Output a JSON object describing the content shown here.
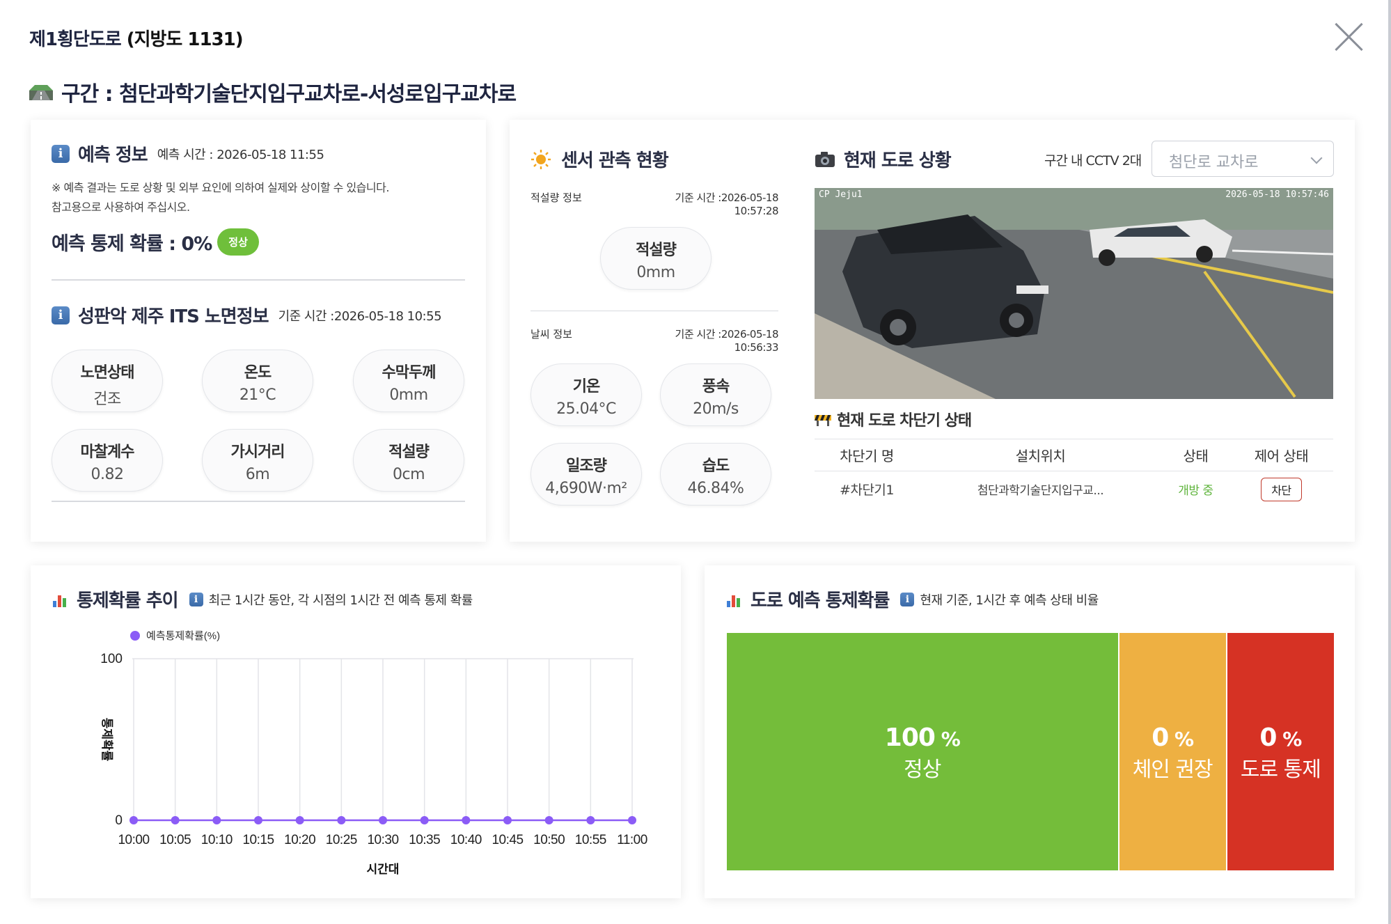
{
  "header": {
    "road_name": "제1횡단도로",
    "road_code": "(지방도 1131)",
    "section": "구간 : 첨단과학기술단지입구교차로-서성로입구교차로"
  },
  "prediction": {
    "title": "예측 정보",
    "time": "예측 시간 : 2026-05-18 11:55",
    "note_line1": "※ 예측 결과는 도로 상황 및 외부 요인에 의하여 실제와 상이할 수 있습니다.",
    "note_line2": "참고용으로 사용하여 주십시오.",
    "prob_label": "예측 통제 확률 : 0%",
    "badge": "정상"
  },
  "its": {
    "title": "성판악 제주 ITS 노면정보",
    "time": "기준 시간 :2026-05-18 10:55",
    "items": [
      {
        "label": "노면상태",
        "value": "건조"
      },
      {
        "label": "온도",
        "value": "21°C"
      },
      {
        "label": "수막두께",
        "value": "0mm"
      },
      {
        "label": "마찰계수",
        "value": "0.82"
      },
      {
        "label": "가시거리",
        "value": "6m"
      },
      {
        "label": "적설량",
        "value": "0cm"
      }
    ]
  },
  "sensor": {
    "title": "센서 관측 현황",
    "snow_label": "적설량 정보",
    "snow_time": "기준 시간 :2026-05-18 10:57:28",
    "snow": {
      "label": "적설량",
      "value": "0mm"
    },
    "weather_label": "날씨 정보",
    "weather_time": "기준 시간 :2026-05-18 10:56:33",
    "weather": [
      {
        "label": "기온",
        "value": "25.04°C"
      },
      {
        "label": "풍속",
        "value": "20m/s"
      },
      {
        "label": "일조량",
        "value": "4,690W·m²"
      },
      {
        "label": "습도",
        "value": "46.84%"
      }
    ]
  },
  "road_status": {
    "title": "현재 도로 상황",
    "cctv_count": "구간 내 CCTV 2대",
    "cctv_select": "첨단로 교차로",
    "cctv_timestamp": "2026-05-18 10:57:46",
    "cctv_tag": "CP Jeju1",
    "barrier_title": "현재 도로 차단기 상태",
    "barrier_headers": [
      "차단기 명",
      "설치위치",
      "상태",
      "제어 상태"
    ],
    "barrier_rows": [
      {
        "name": "#차단기1",
        "location": "첨단과학기술단지입구교...",
        "status": "개방 중",
        "control": "차단"
      }
    ]
  },
  "trend": {
    "title": "통제확률 추이",
    "desc": "최근 1시간 동안, 각 시점의 1시간 전 예측 통제 확률"
  },
  "forecast": {
    "title": "도로 예측 통제확률",
    "desc": "현재 기준, 1시간 후 예측 상태 비율",
    "segments": [
      {
        "pct": "100",
        "unit": "%",
        "label": "정상",
        "value": 100,
        "color": "#74bd3a"
      },
      {
        "pct": "0",
        "unit": "%",
        "label": "체인 권장",
        "value": 0,
        "color": "#eeb042"
      },
      {
        "pct": "0",
        "unit": "%",
        "label": "도로 통제",
        "value": 0,
        "color": "#d63224"
      }
    ]
  },
  "chart_data": {
    "type": "line",
    "title": "",
    "xlabel": "시간대",
    "ylabel": "통제확률",
    "ylim": [
      0,
      100
    ],
    "yticks": [
      "0",
      "100"
    ],
    "legend": "top-left",
    "grid": true,
    "series_color": "#8b5cf6",
    "x": [
      "10:00",
      "10:05",
      "10:10",
      "10:15",
      "10:20",
      "10:25",
      "10:30",
      "10:35",
      "10:40",
      "10:45",
      "10:50",
      "10:55",
      "11:00"
    ],
    "series": [
      {
        "name": "예측통제확률(%)",
        "values": [
          0,
          0,
          0,
          0,
          0,
          0,
          0,
          0,
          0,
          0,
          0,
          0,
          0
        ]
      }
    ]
  }
}
